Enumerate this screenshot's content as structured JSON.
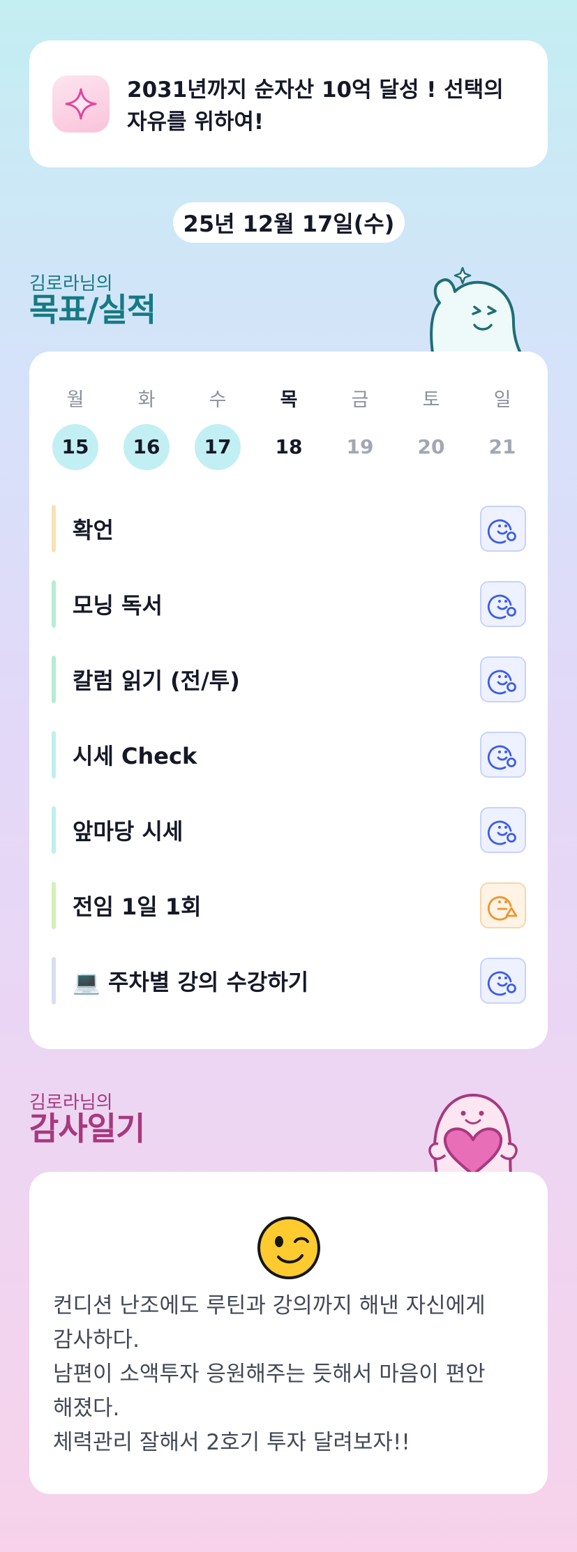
{
  "goal": {
    "icon": "sparkle-icon",
    "line1": "2031년까지 순자산 10억 달성 ! 선택의",
    "line2": "자유를 위하여!"
  },
  "date": "25년 12월 17일(수)",
  "goals_section": {
    "subtitle": "김로라님의",
    "title": "목표/실적"
  },
  "week": {
    "days": [
      {
        "label": "월",
        "date": "15",
        "state": "done"
      },
      {
        "label": "화",
        "date": "16",
        "state": "done"
      },
      {
        "label": "수",
        "date": "17",
        "state": "done"
      },
      {
        "label": "목",
        "date": "18",
        "state": "today"
      },
      {
        "label": "금",
        "date": "19",
        "state": "future"
      },
      {
        "label": "토",
        "date": "20",
        "state": "future"
      },
      {
        "label": "일",
        "date": "21",
        "state": "future"
      }
    ]
  },
  "habits": [
    {
      "label": "확언",
      "bar_color": "#f9e0b4",
      "status_icon": "smile-face-icon",
      "status_color": "#3b5ce8"
    },
    {
      "label": "모닝 독서",
      "bar_color": "#b6ecd6",
      "status_icon": "smile-face-icon",
      "status_color": "#3b5ce8"
    },
    {
      "label": "칼럼 읽기 (전/투)",
      "bar_color": "#b6ecd6",
      "status_icon": "smile-face-icon",
      "status_color": "#3b5ce8"
    },
    {
      "label": "시세 Check",
      "bar_color": "#bfeef0",
      "status_icon": "smile-face-icon",
      "status_color": "#3b5ce8"
    },
    {
      "label": "앞마당 시세",
      "bar_color": "#bfeef0",
      "status_icon": "smile-face-icon",
      "status_color": "#3b5ce8"
    },
    {
      "label": "전임 1일 1회",
      "bar_color": "#d3f0b8",
      "status_icon": "meh-face-icon",
      "status_color": "#f0942b"
    },
    {
      "label": "💻 주차별 강의 수강하기",
      "bar_color": "#d8def5",
      "status_icon": "smile-face-icon",
      "status_color": "#3b5ce8"
    }
  ],
  "gratitude_section": {
    "subtitle": "김로라님의",
    "title": "감사일기"
  },
  "gratitude": {
    "emoji": "winking-face-icon",
    "lines": [
      "컨디션 난조에도 루틴과 강의까지 해낸 자신에게",
      "감사하다.",
      "남편이 소액투자 응원해주는 듯해서 마음이 편안",
      "해졌다.",
      "체력관리 잘해서 2호기 투자 달려보자!!"
    ]
  }
}
